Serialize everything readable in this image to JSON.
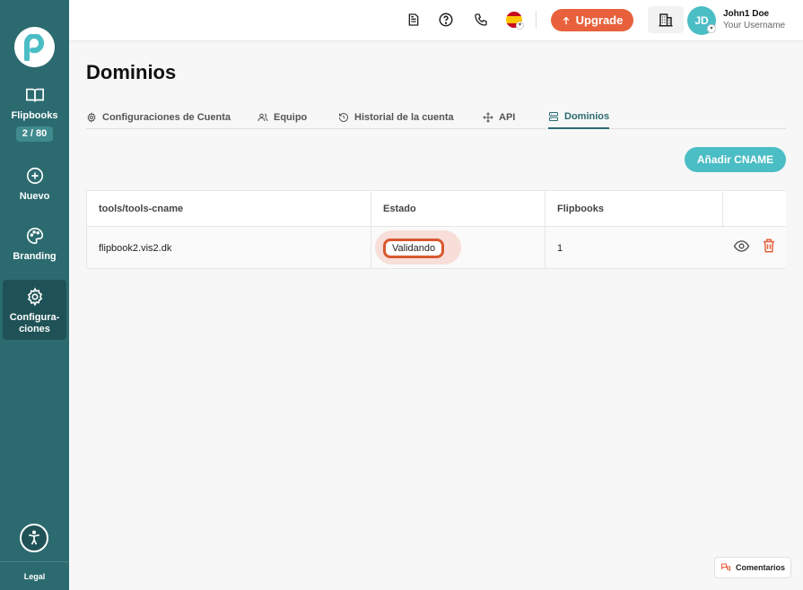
{
  "sidebar": {
    "items": [
      {
        "label": "Flipbooks",
        "badge": "2 / 80",
        "icon": "book-open-icon"
      },
      {
        "label": "Nuevo",
        "icon": "plus-circle-icon"
      },
      {
        "label": "Branding",
        "icon": "palette-icon"
      },
      {
        "label_line1": "Configura-",
        "label_line2": "ciones",
        "icon": "gear-icon",
        "active": true
      }
    ],
    "legal_label": "Legal"
  },
  "header": {
    "upgrade_label": "Upgrade",
    "user_name": "John1 Doe",
    "user_subtitle": "Your Username",
    "avatar_initials": "JD"
  },
  "page": {
    "title": "Dominios",
    "tabs": [
      {
        "label": "Configuraciones de Cuenta",
        "icon": "gear-icon"
      },
      {
        "label": "Equipo",
        "icon": "users-icon"
      },
      {
        "label": "Historial de la cuenta",
        "icon": "history-icon"
      },
      {
        "label": "API",
        "icon": "move-icon"
      },
      {
        "label": "Dominios",
        "icon": "server-icon",
        "active": true
      }
    ],
    "add_button_label": "Añadir CNAME"
  },
  "table": {
    "headers": [
      "tools/tools-cname",
      "Estado",
      "Flipbooks",
      ""
    ],
    "rows": [
      {
        "domain": "flipbook2.vis2.dk",
        "status": "Validando",
        "flipbooks": "1"
      }
    ]
  },
  "feedback": {
    "label": "Comentarios"
  },
  "colors": {
    "sidebar": "#2b6b6f",
    "accent": "#4bbdc5",
    "upgrade": "#e8613c",
    "danger": "#e8613c"
  }
}
